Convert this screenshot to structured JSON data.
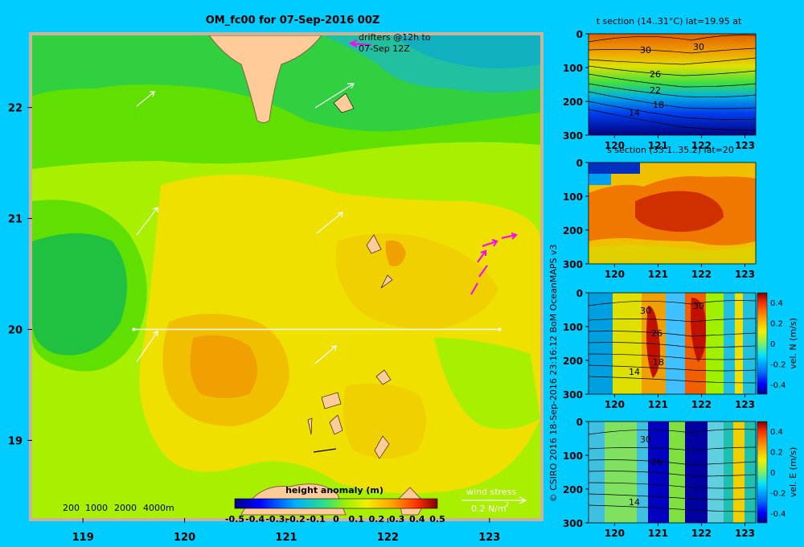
{
  "chart_data": [
    {
      "type": "heatmap",
      "title": "OM_fc00 for 07-Sep-2016 00Z",
      "x_ticks": [
        119,
        120,
        121,
        122,
        123
      ],
      "y_ticks": [
        19,
        20,
        21,
        22
      ],
      "xlim": [
        118.5,
        123.5
      ],
      "ylim": [
        18.3,
        22.65
      ],
      "colorbar": {
        "label": "height anomaly (m)",
        "ticks": [
          "-0.5",
          "-0.4",
          "-0.3",
          "-0.2",
          "-0.1",
          "0",
          "0.1",
          "0.2",
          "0.3",
          "0.4",
          "0.5"
        ],
        "range": [
          -0.5,
          0.5
        ]
      },
      "annotations": {
        "drifters_line1": "drifters @12h to",
        "drifters_line2": "07-Sep 12Z",
        "depth_legend": [
          "200",
          "1000",
          "2000",
          "4000m"
        ],
        "wind_stress": "wind stress",
        "wind_scale_text": "0.2 N/m",
        "wind_scale_exp": "2"
      },
      "section_line": {
        "lat": 20,
        "lon": [
          119.5,
          123.1
        ]
      }
    },
    {
      "type": "heatmap",
      "title": "t section (14..31°C) lat=19.95 at",
      "x_ticks": [
        120,
        121,
        122,
        123
      ],
      "y_ticks": [
        0,
        100,
        200,
        300
      ],
      "contour_labels": [
        "30",
        "30",
        "26",
        "22",
        "18",
        "14"
      ]
    },
    {
      "type": "heatmap",
      "title": "s section (33.1..35.2) lat=20",
      "x_ticks": [
        120,
        121,
        122,
        123
      ],
      "y_ticks": [
        0,
        100,
        200,
        300
      ]
    },
    {
      "type": "heatmap",
      "title": "",
      "colorbar": {
        "label": "vel. N (m/s)",
        "ticks": [
          "0.4",
          "0.2",
          "0",
          "-0.2",
          "-0.4"
        ]
      },
      "x_ticks": [
        120,
        121,
        122,
        123
      ],
      "y_ticks": [
        0,
        100,
        200,
        300
      ],
      "contour_labels": [
        "30",
        "30",
        "26",
        "18",
        "14"
      ]
    },
    {
      "type": "heatmap",
      "title": "",
      "colorbar": {
        "label": "vel. E (m/s)",
        "ticks": [
          "0.4",
          "0.2",
          "0",
          "-0.2",
          "-0.4"
        ]
      },
      "x_ticks": [
        120,
        121,
        122,
        123
      ],
      "y_ticks": [
        0,
        100,
        200,
        300
      ],
      "contour_labels": [
        "30",
        "26",
        "14"
      ]
    }
  ],
  "credit": "© CSIRO 2016   18-Sep-2016 23:16:12 BoM OceanMAPS v3"
}
